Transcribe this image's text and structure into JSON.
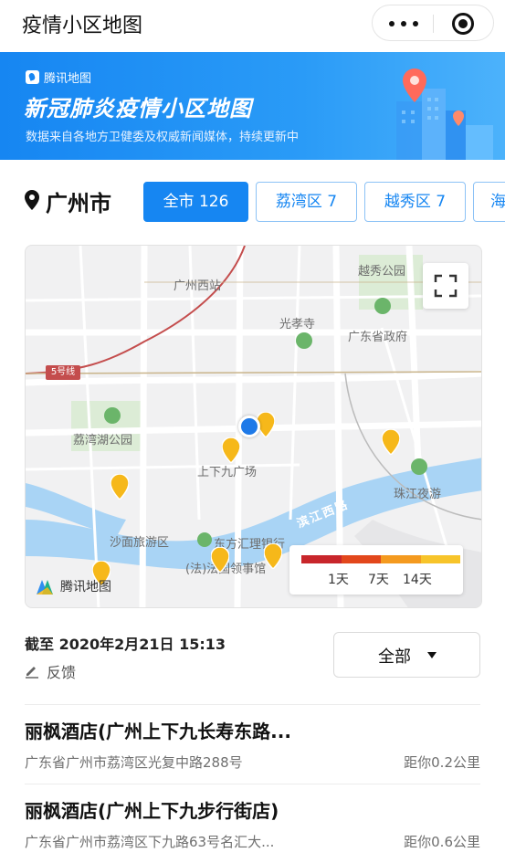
{
  "app": {
    "title": "疫情小区地图"
  },
  "banner": {
    "brand": "腾讯地图",
    "headline": "新冠肺炎疫情小区地图",
    "subline": "数据来自各地方卫健委及权威新闻媒体，持续更新中"
  },
  "city": {
    "name": "广州市"
  },
  "tabs": [
    {
      "label": "全市 126",
      "active": true
    },
    {
      "label": "荔湾区 7",
      "active": false
    },
    {
      "label": "越秀区 7",
      "active": false
    },
    {
      "label": "海",
      "active": false
    }
  ],
  "map": {
    "pois": {
      "guangzhou_west_station": "广州西站",
      "yuexiu_park": "越秀公园",
      "guangxiao_temple": "光孝寺",
      "provincial_gov": "广东省政府",
      "liwan_lake_park": "荔湾湖公园",
      "shangxiajiu": "上下九广场",
      "pearl_river_night": "珠江夜游",
      "shamian": "沙面旅游区",
      "french_consulate": "(法)法国领事馆",
      "hsbc": "东方汇理银行",
      "binjiang_west_rd": "滨江西路"
    },
    "metro_tag": "5号线",
    "logo": "腾讯地图",
    "legend": {
      "labels": [
        "1天",
        "7天",
        "14天"
      ],
      "colors": [
        "#c8262b",
        "#e2471c",
        "#f49a1f",
        "#f7c42a"
      ]
    },
    "marker_color": "#f6b81a",
    "location_color": "#1f7ae8"
  },
  "info": {
    "as_of": "截至 2020年2月21日 15:13",
    "feedback": "反馈",
    "filter_value": "全部"
  },
  "list": [
    {
      "name": "丽枫酒店(广州上下九长寿东路...",
      "address": "广东省广州市荔湾区光复中路288号",
      "distance": "距你0.2公里"
    },
    {
      "name": "丽枫酒店(广州上下九步行街店)",
      "address": "广东省广州市荔湾区下九路63号名汇大...",
      "distance": "距你0.6公里"
    }
  ],
  "colors": {
    "accent": "#1686f2"
  }
}
